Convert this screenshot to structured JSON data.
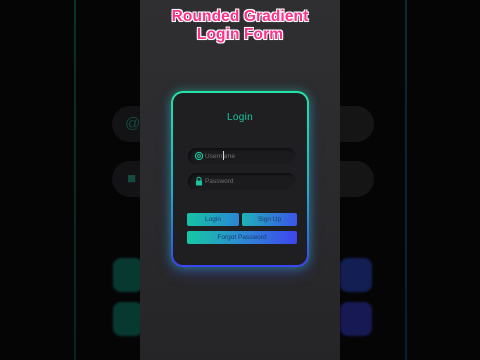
{
  "heading": {
    "line1": "Rounded Gradient",
    "line2": "Login Form"
  },
  "login_form": {
    "title": "Login",
    "username": {
      "placeholder": "Username",
      "value": "",
      "icon": "at-sign-icon"
    },
    "password": {
      "placeholder": "Password",
      "value": "",
      "icon": "lock-icon"
    },
    "buttons": {
      "login": "Login",
      "signup": "Sign Up",
      "forgot": "Forgot Password"
    }
  },
  "colors": {
    "heading": "#ff2f8a",
    "title": "#19c6a1",
    "gradient_start": "#22e3a5",
    "gradient_end": "#3a46f0",
    "card_background": "#1f1f21"
  }
}
